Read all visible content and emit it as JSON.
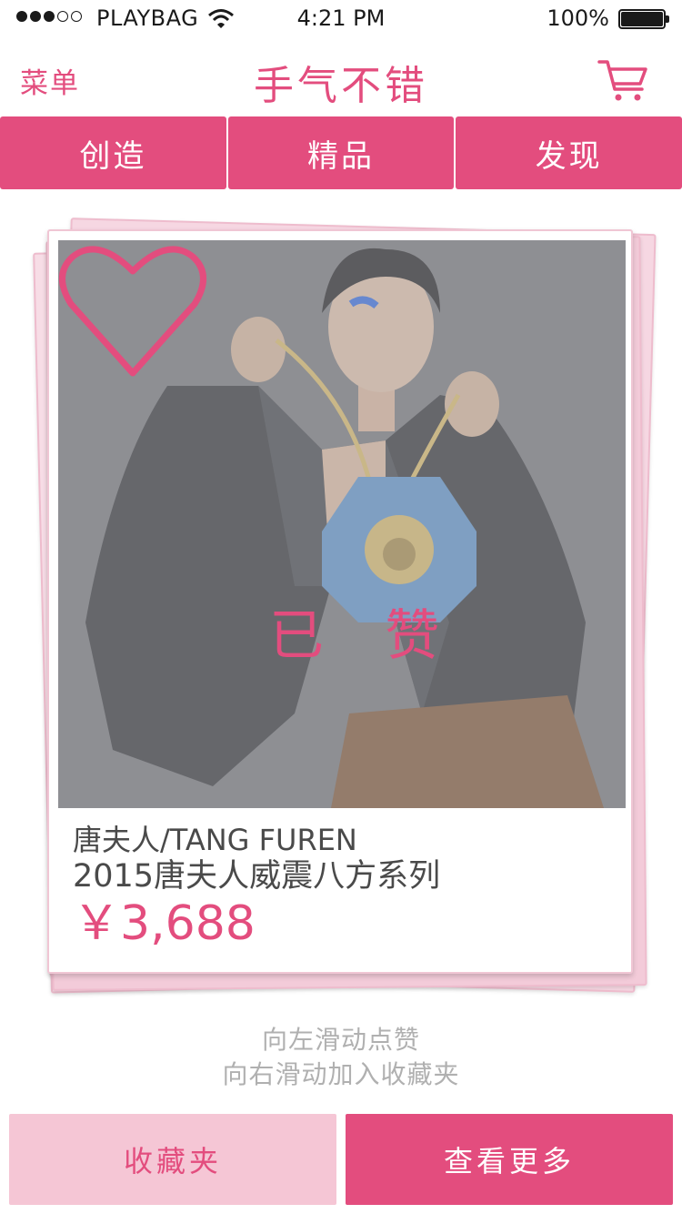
{
  "status_bar": {
    "carrier": "PLAYBAG",
    "time": "4:21 PM",
    "battery": "100%"
  },
  "nav": {
    "menu_label": "菜单",
    "title": "手气不错",
    "cart_icon": "cart-icon"
  },
  "tabs": [
    {
      "label": "创造"
    },
    {
      "label": "精品"
    },
    {
      "label": "发现"
    }
  ],
  "card": {
    "liked_label": "已 赞",
    "brand": "唐夫人/TANG FUREN",
    "product_name": "2015唐夫人威震八方系列",
    "price": "￥3,688"
  },
  "hints": {
    "swipe_left": "向左滑动点赞",
    "swipe_right": "向右滑动加入收藏夹"
  },
  "actions": {
    "favorites_label": "收藏夹",
    "more_label": "查看更多"
  },
  "colors": {
    "accent": "#e34d7e",
    "accent_light": "#f5c6d5"
  }
}
